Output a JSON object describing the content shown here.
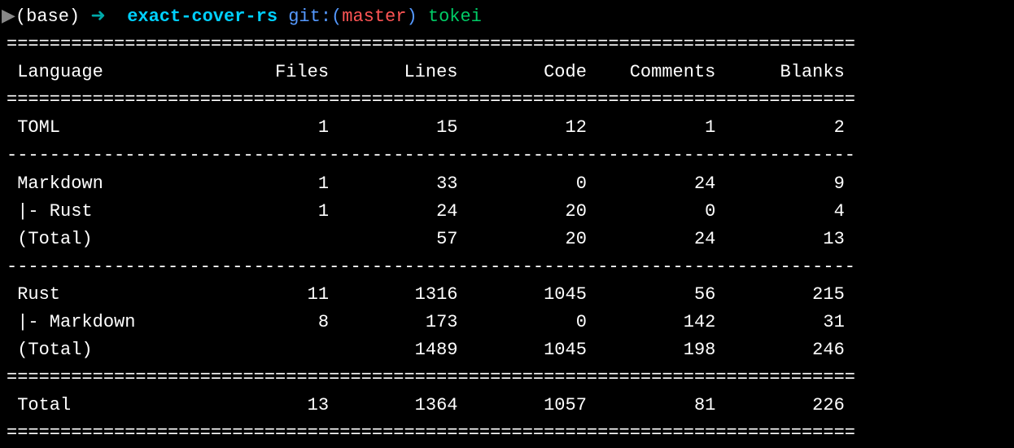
{
  "prompt": {
    "caret": "▶",
    "base": "(base)",
    "arrow": "➜",
    "path": "exact-cover-rs",
    "git_label": "git:",
    "paren_open": "(",
    "branch": "master",
    "paren_close": ")",
    "command": "tokei"
  },
  "tokei": {
    "headers": {
      "language": "Language",
      "files": "Files",
      "lines": "Lines",
      "code": "Code",
      "comments": "Comments",
      "blanks": "Blanks"
    },
    "sections": [
      {
        "rows": [
          {
            "label": "TOML",
            "files": "1",
            "lines": "15",
            "code": "12",
            "comments": "1",
            "blanks": "2"
          }
        ]
      },
      {
        "rows": [
          {
            "label": "Markdown",
            "files": "1",
            "lines": "33",
            "code": "0",
            "comments": "24",
            "blanks": "9"
          },
          {
            "label": "|- Rust",
            "files": "1",
            "lines": "24",
            "code": "20",
            "comments": "0",
            "blanks": "4"
          },
          {
            "label": "(Total)",
            "files": "",
            "lines": "57",
            "code": "20",
            "comments": "24",
            "blanks": "13"
          }
        ]
      },
      {
        "rows": [
          {
            "label": "Rust",
            "files": "11",
            "lines": "1316",
            "code": "1045",
            "comments": "56",
            "blanks": "215"
          },
          {
            "label": "|- Markdown",
            "files": "8",
            "lines": "173",
            "code": "0",
            "comments": "142",
            "blanks": "31"
          },
          {
            "label": "(Total)",
            "files": "",
            "lines": "1489",
            "code": "1045",
            "comments": "198",
            "blanks": "246"
          }
        ]
      }
    ],
    "total": {
      "label": "Total",
      "files": "13",
      "lines": "1364",
      "code": "1057",
      "comments": "81",
      "blanks": "226"
    },
    "rule_double": "===============================================================================",
    "rule_single": "-------------------------------------------------------------------------------"
  },
  "col_widths": {
    "language": 21,
    "files": 8,
    "lines": 12,
    "code": 12,
    "comments": 12,
    "blanks": 12
  }
}
